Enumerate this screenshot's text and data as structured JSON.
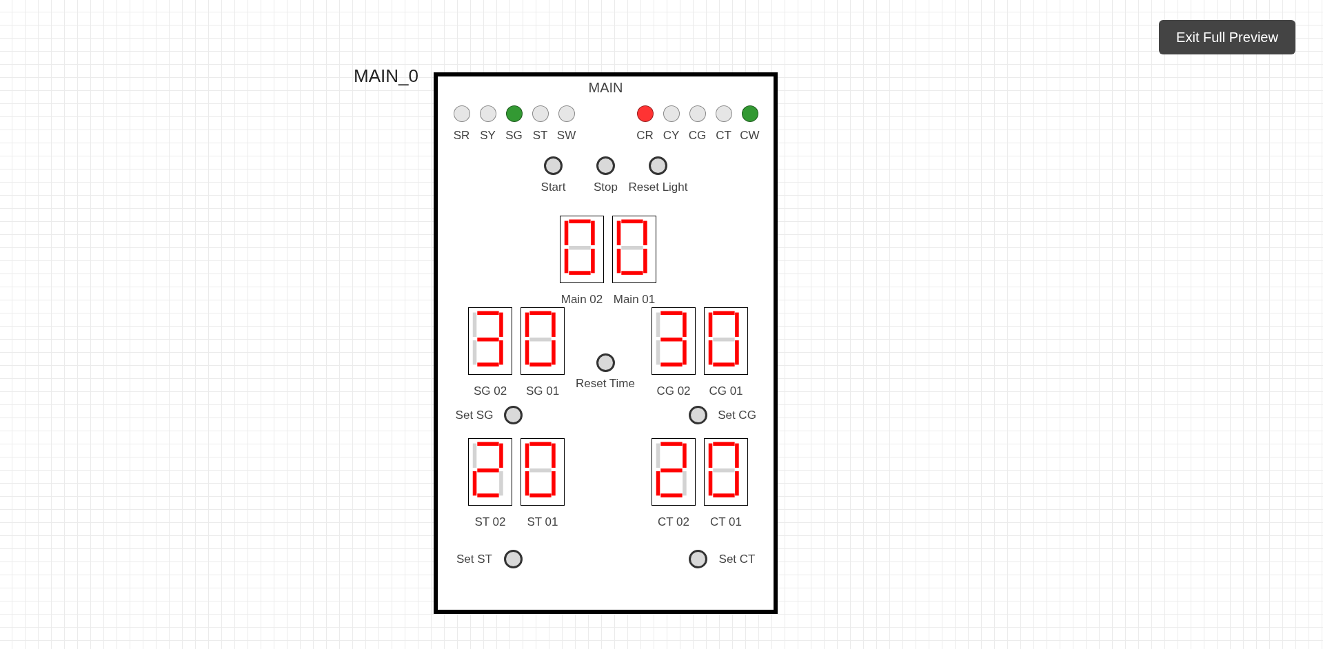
{
  "toolbar": {
    "exit_button": "Exit Full Preview"
  },
  "component": {
    "name_label": "MAIN_0",
    "panel": {
      "title": "MAIN",
      "light_groups": [
        [
          {
            "label": "SR",
            "color": "#e6e6e6"
          },
          {
            "label": "SY",
            "color": "#e6e6e6"
          },
          {
            "label": "SG",
            "color": "#339933"
          },
          {
            "label": "ST",
            "color": "#e6e6e6"
          },
          {
            "label": "SW",
            "color": "#e6e6e6"
          }
        ],
        [
          {
            "label": "CR",
            "color": "#ff3333"
          },
          {
            "label": "CY",
            "color": "#e6e6e6"
          },
          {
            "label": "CG",
            "color": "#e6e6e6"
          },
          {
            "label": "CT",
            "color": "#e6e6e6"
          },
          {
            "label": "CW",
            "color": "#339933"
          }
        ]
      ],
      "buttons": [
        {
          "label": "Start"
        },
        {
          "label": "Stop"
        },
        {
          "label": "Reset Light"
        }
      ],
      "main_displays": [
        {
          "label": "Main 02",
          "segments": {
            "top": true,
            "top_right": true,
            "bottom_right": true,
            "bottom": true,
            "bottom_left": true,
            "top_left": true,
            "middle": false
          }
        },
        {
          "label": "Main 01",
          "segments": {
            "top": true,
            "top_right": true,
            "bottom_right": true,
            "bottom": true,
            "bottom_left": true,
            "top_left": true,
            "middle": false
          }
        }
      ],
      "timer_rows": [
        {
          "left_displays": [
            {
              "label": "SG 02",
              "segments": {
                "top": true,
                "top_right": true,
                "bottom_right": true,
                "bottom": true,
                "bottom_left": false,
                "top_left": false,
                "middle": true
              }
            },
            {
              "label": "SG 01",
              "segments": {
                "top": true,
                "top_right": true,
                "bottom_right": true,
                "bottom": true,
                "bottom_left": true,
                "top_left": true,
                "middle": false
              }
            }
          ],
          "center_button": {
            "label": "Reset Time"
          },
          "right_displays": [
            {
              "label": "CG 02",
              "segments": {
                "top": true,
                "top_right": true,
                "bottom_right": true,
                "bottom": true,
                "bottom_left": false,
                "top_left": false,
                "middle": true
              }
            },
            {
              "label": "CG 01",
              "segments": {
                "top": true,
                "top_right": true,
                "bottom_right": true,
                "bottom": true,
                "bottom_left": true,
                "top_left": true,
                "middle": false
              }
            }
          ],
          "left_set_button": {
            "label": "Set SG"
          },
          "right_set_button": {
            "label": "Set CG"
          }
        },
        {
          "left_displays": [
            {
              "label": "ST 02",
              "segments": {
                "top": true,
                "top_right": true,
                "bottom_right": false,
                "bottom": true,
                "bottom_left": true,
                "top_left": false,
                "middle": true
              }
            },
            {
              "label": "ST 01",
              "segments": {
                "top": true,
                "top_right": true,
                "bottom_right": true,
                "bottom": true,
                "bottom_left": true,
                "top_left": true,
                "middle": false
              }
            }
          ],
          "right_displays": [
            {
              "label": "CT 02",
              "segments": {
                "top": true,
                "top_right": true,
                "bottom_right": false,
                "bottom": true,
                "bottom_left": true,
                "top_left": false,
                "middle": true
              }
            },
            {
              "label": "CT 01",
              "segments": {
                "top": true,
                "top_right": true,
                "bottom_right": true,
                "bottom": true,
                "bottom_left": true,
                "top_left": true,
                "middle": false
              }
            }
          ],
          "left_set_button": {
            "label": "Set ST"
          },
          "right_set_button": {
            "label": "Set CT"
          }
        }
      ]
    }
  }
}
